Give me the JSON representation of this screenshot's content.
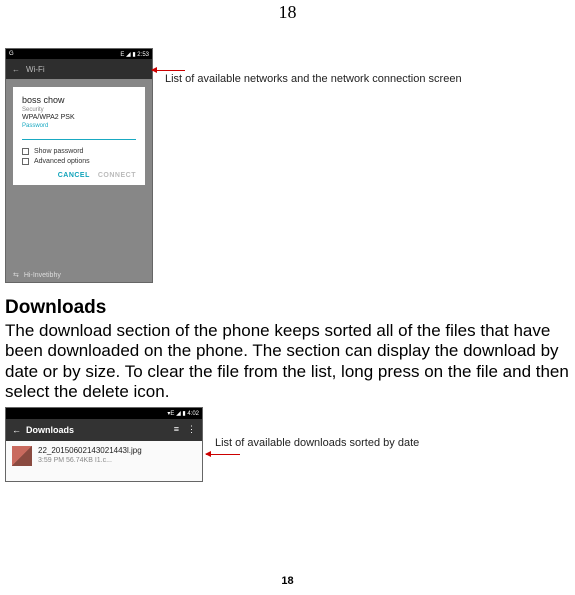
{
  "page": {
    "top_number": "18",
    "bottom_number": "18"
  },
  "figure1": {
    "statusbar": {
      "left": "G",
      "right": "E ◢ ▮ 2:53"
    },
    "wifi_header": {
      "back": "←",
      "title": "Wi-Fi"
    },
    "dialog": {
      "title": "boss chow",
      "security_label": "Security",
      "security_value": "WPA/WPA2 PSK",
      "password_label": "Password",
      "show_password": "Show password",
      "advanced": "Advanced options",
      "cancel": "CANCEL",
      "connect": "CONNECT"
    },
    "bottom_network": "Hi-Invetibhy",
    "caption": "List of available networks and the network connection screen"
  },
  "heading_downloads": "Downloads",
  "body_downloads": "The download section of the phone keeps sorted all of the files that have been downloaded on the phone. The section can display the download by date or by size. To clear the file from the list, long press on the file and then select the delete icon.",
  "figure2": {
    "statusbar": {
      "left": "",
      "right": "▾E ◢ ▮ 4:02"
    },
    "header": {
      "arrow": "←",
      "title": "Downloads",
      "sort_icon": "≡",
      "more_icon": "⋮"
    },
    "item": {
      "name": "22_20150602143021443l.jpg",
      "meta": "3:59 PM      56.74KB      I1.c..."
    },
    "caption": "List of available downloads sorted by date"
  }
}
